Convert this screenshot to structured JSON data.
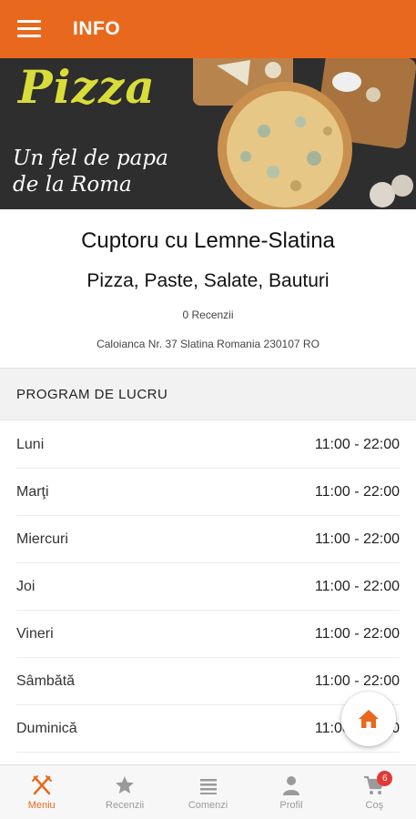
{
  "header": {
    "title": "INFO"
  },
  "banner": {
    "title": "Pizza",
    "subtitle": "Un fel de papa de la Roma"
  },
  "restaurant": {
    "name": "Cuptoru cu Lemne-Slatina",
    "categories": "Pizza, Paste, Salate, Bauturi",
    "reviews": "0 Recenzii",
    "address": "Caloianca Nr. 37 Slatina Romania 230107 RO"
  },
  "schedule": {
    "title": "PROGRAM DE LUCRU",
    "days": [
      {
        "day": "Luni",
        "hours": "11:00 - 22:00"
      },
      {
        "day": "Marţi",
        "hours": "11:00 - 22:00"
      },
      {
        "day": "Miercuri",
        "hours": "11:00 - 22:00"
      },
      {
        "day": "Joi",
        "hours": "11:00 - 22:00"
      },
      {
        "day": "Vineri",
        "hours": "11:00 - 22:00"
      },
      {
        "day": "Sâmbătă",
        "hours": "11:00 - 22:00"
      },
      {
        "day": "Duminică",
        "hours": "11:00 - 22:00"
      }
    ]
  },
  "nav": {
    "items": [
      {
        "label": "Meniu",
        "icon": "fork-knife-icon",
        "active": true
      },
      {
        "label": "Recenzii",
        "icon": "star-icon",
        "active": false
      },
      {
        "label": "Comenzi",
        "icon": "list-icon",
        "active": false
      },
      {
        "label": "Profil",
        "icon": "person-icon",
        "active": false
      },
      {
        "label": "Coş",
        "icon": "cart-icon",
        "active": false,
        "badge": "6"
      }
    ]
  },
  "colors": {
    "accent": "#e8691e",
    "badge": "#e53935",
    "inactive": "#9a9a9a"
  }
}
